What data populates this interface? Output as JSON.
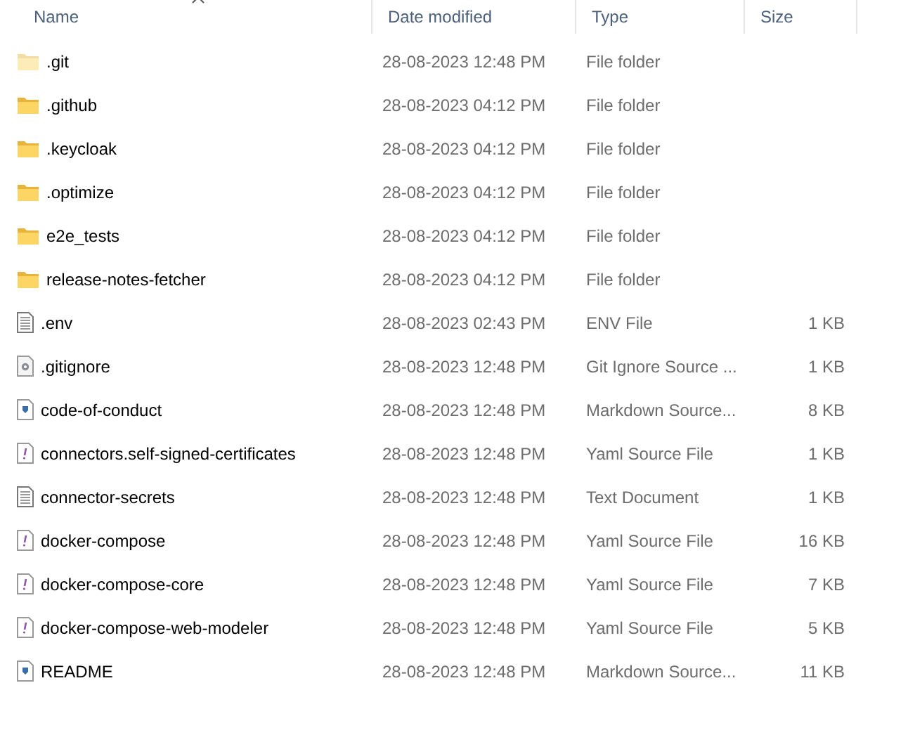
{
  "columns": [
    {
      "label": "Name",
      "sorted": true
    },
    {
      "label": "Date modified",
      "sorted": false
    },
    {
      "label": "Type",
      "sorted": false
    },
    {
      "label": "Size",
      "sorted": false
    }
  ],
  "rows": [
    {
      "kind": "folder",
      "hidden": true,
      "name": ".git",
      "date": "28-08-2023 12:48 PM",
      "type": "File folder"
    },
    {
      "kind": "folder",
      "hidden": false,
      "name": ".github",
      "date": "28-08-2023 04:12 PM",
      "type": "File folder"
    },
    {
      "kind": "folder",
      "hidden": false,
      "name": ".keycloak",
      "date": "28-08-2023 04:12 PM",
      "type": "File folder"
    },
    {
      "kind": "folder",
      "hidden": false,
      "name": ".optimize",
      "date": "28-08-2023 04:12 PM",
      "type": "File folder"
    },
    {
      "kind": "folder",
      "hidden": false,
      "name": "e2e_tests",
      "date": "28-08-2023 04:12 PM",
      "type": "File folder"
    },
    {
      "kind": "folder",
      "hidden": false,
      "name": "release-notes-fetcher",
      "date": "28-08-2023 04:12 PM",
      "type": "File folder"
    },
    {
      "kind": "text",
      "hidden": false,
      "name": ".env",
      "date": "28-08-2023 02:43 PM",
      "type": "ENV File",
      "size": "1 KB"
    },
    {
      "kind": "settings",
      "hidden": false,
      "name": ".gitignore",
      "date": "28-08-2023 12:48 PM",
      "type": "Git Ignore Source ...",
      "size": "1 KB"
    },
    {
      "kind": "markdown",
      "hidden": false,
      "name": "code-of-conduct",
      "date": "28-08-2023 12:48 PM",
      "type": "Markdown Source...",
      "size": "8 KB"
    },
    {
      "kind": "yaml",
      "hidden": false,
      "name": "connectors.self-signed-certificates",
      "date": "28-08-2023 12:48 PM",
      "type": "Yaml Source File",
      "size": "1 KB"
    },
    {
      "kind": "text",
      "hidden": false,
      "name": "connector-secrets",
      "date": "28-08-2023 12:48 PM",
      "type": "Text Document",
      "size": "1 KB"
    },
    {
      "kind": "yaml",
      "hidden": false,
      "name": "docker-compose",
      "date": "28-08-2023 12:48 PM",
      "type": "Yaml Source File",
      "size": "16 KB"
    },
    {
      "kind": "yaml",
      "hidden": false,
      "name": "docker-compose-core",
      "date": "28-08-2023 12:48 PM",
      "type": "Yaml Source File",
      "size": "7 KB"
    },
    {
      "kind": "yaml",
      "hidden": false,
      "name": "docker-compose-web-modeler",
      "date": "28-08-2023 12:48 PM",
      "type": "Yaml Source File",
      "size": "5 KB"
    },
    {
      "kind": "markdown",
      "hidden": false,
      "name": "README",
      "date": "28-08-2023 12:48 PM",
      "type": "Markdown Source...",
      "size": "11 KB"
    }
  ]
}
